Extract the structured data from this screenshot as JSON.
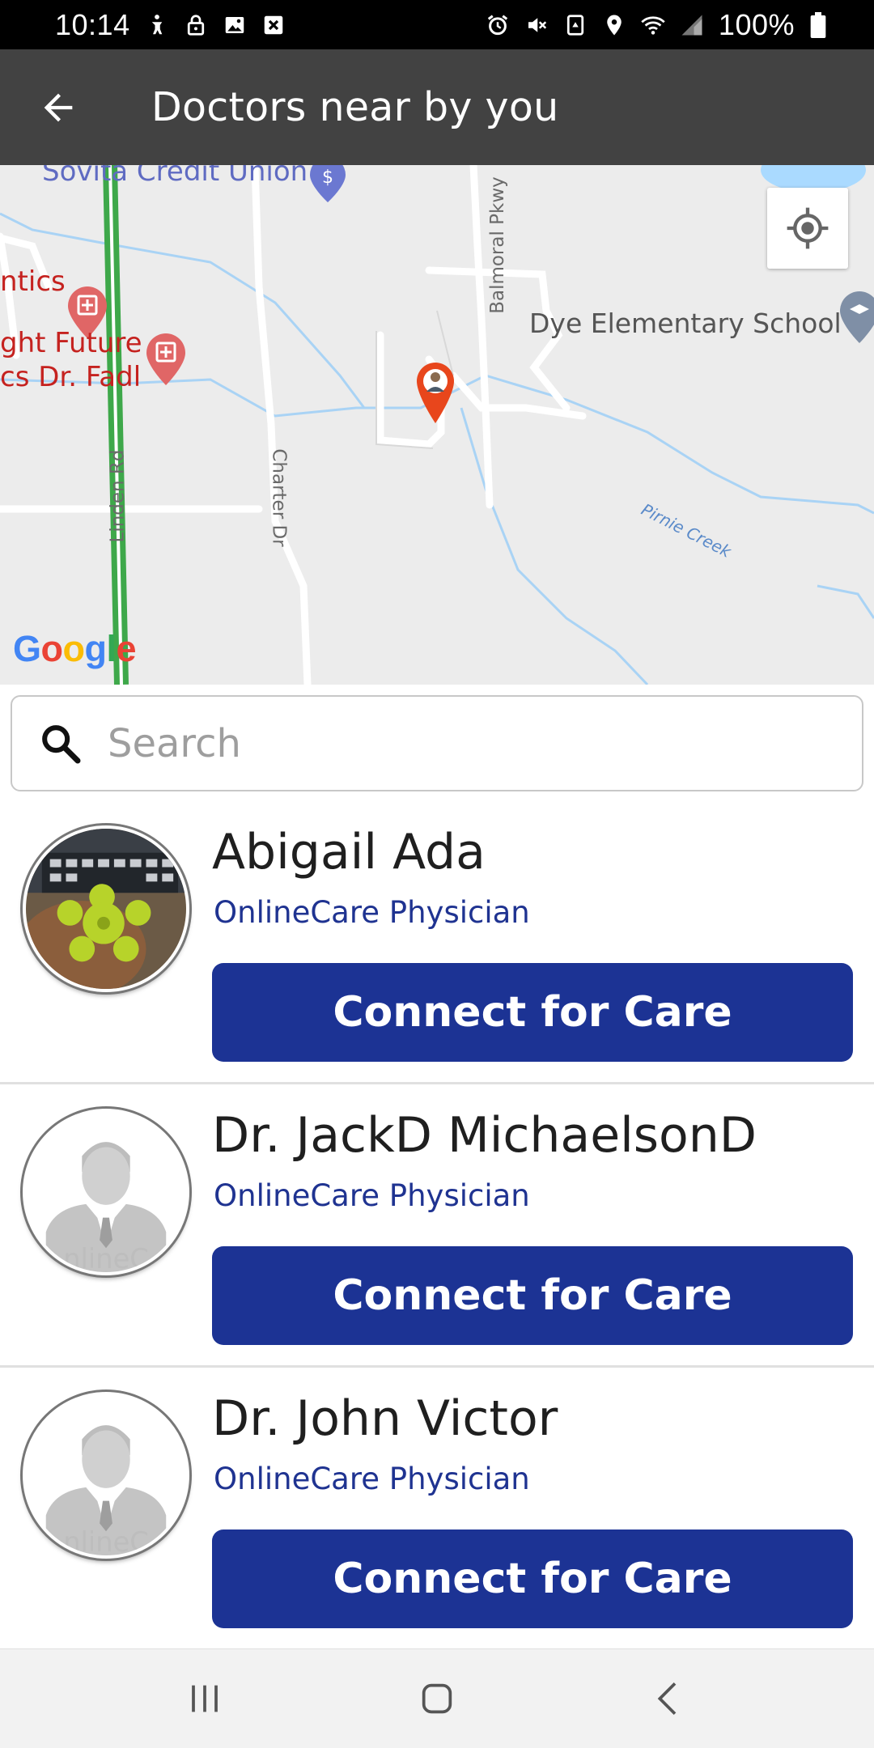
{
  "status_bar": {
    "time": "10:14",
    "battery": "100%",
    "left_icons": [
      "accessibility-icon",
      "lock-icon",
      "image-icon",
      "close-box-icon"
    ],
    "right_icons": [
      "alarm-icon",
      "mute-icon",
      "recycle-icon",
      "location-icon",
      "wifi-icon",
      "signal-icon",
      "battery-icon"
    ]
  },
  "app_bar": {
    "title": "Doctors near by you",
    "back_icon": "arrow-back-icon"
  },
  "map": {
    "labels": {
      "credit_union": "Sovita Credit Union",
      "clinic_1": "ntics",
      "clinic_2_line1": "ght Future",
      "clinic_2_line2": "cs Dr. Fadl",
      "school": "Dye Elementary School",
      "road_linden": "Linden Rd",
      "road_charter": "Charter Dr",
      "road_balmoral": "Balmoral Pkwy",
      "creek": "Pirnie Creek"
    },
    "google_logo": [
      "G",
      "o",
      "o",
      "g",
      "l",
      "e"
    ],
    "google_colors": [
      "#4285F4",
      "#EA4335",
      "#FBBC05",
      "#4285F4",
      "#34A853",
      "#EA4335"
    ],
    "locate_icon": "my-location-icon"
  },
  "search": {
    "placeholder": "Search",
    "value": ""
  },
  "doctors": [
    {
      "name": "Abigail Ada",
      "role": "OnlineCare Physician",
      "button": "Connect for Care",
      "avatar": "photo"
    },
    {
      "name": "Dr. JackD MichaelsonD",
      "role": "OnlineCare Physician",
      "button": "Connect for Care",
      "avatar": "placeholder"
    },
    {
      "name": "Dr. John Victor",
      "role": "OnlineCare Physician",
      "button": "Connect for Care",
      "avatar": "placeholder"
    }
  ],
  "nav_bar": {
    "icons": [
      "recent-apps-icon",
      "home-icon",
      "back-icon"
    ]
  },
  "colors": {
    "status_bar": "#000000",
    "app_bar": "#424242",
    "primary_button": "#1c3394",
    "role_text": "#1f3391",
    "map_bg": "#ececec",
    "pin": "#e8461c",
    "poi_red": "#d94b4b"
  }
}
